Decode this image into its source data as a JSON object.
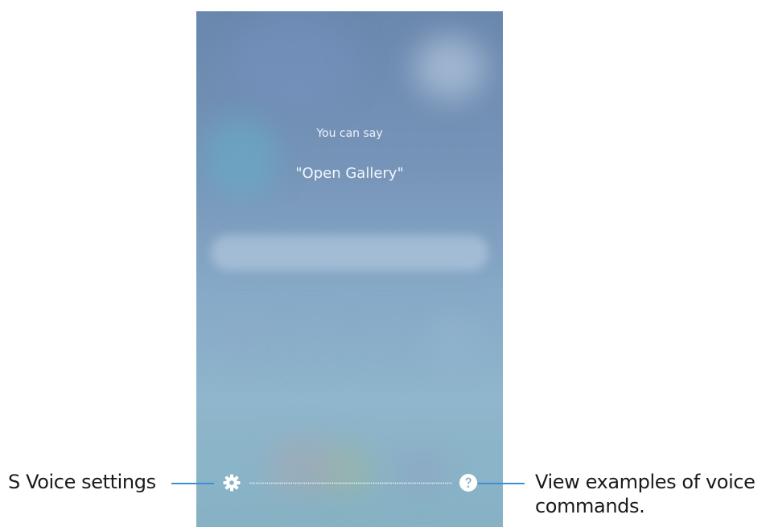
{
  "screen": {
    "hint_label": "You can say",
    "hint_command": "\"Open Gallery\""
  },
  "bottom_bar": {
    "settings_icon": "gear-icon",
    "help_icon": "question-icon"
  },
  "callouts": {
    "left": "S Voice settings",
    "right_line1": "View examples of voice",
    "right_line2": "commands."
  },
  "colors": {
    "callout_line": "#3e8fcf",
    "icon": "#ffffff"
  }
}
